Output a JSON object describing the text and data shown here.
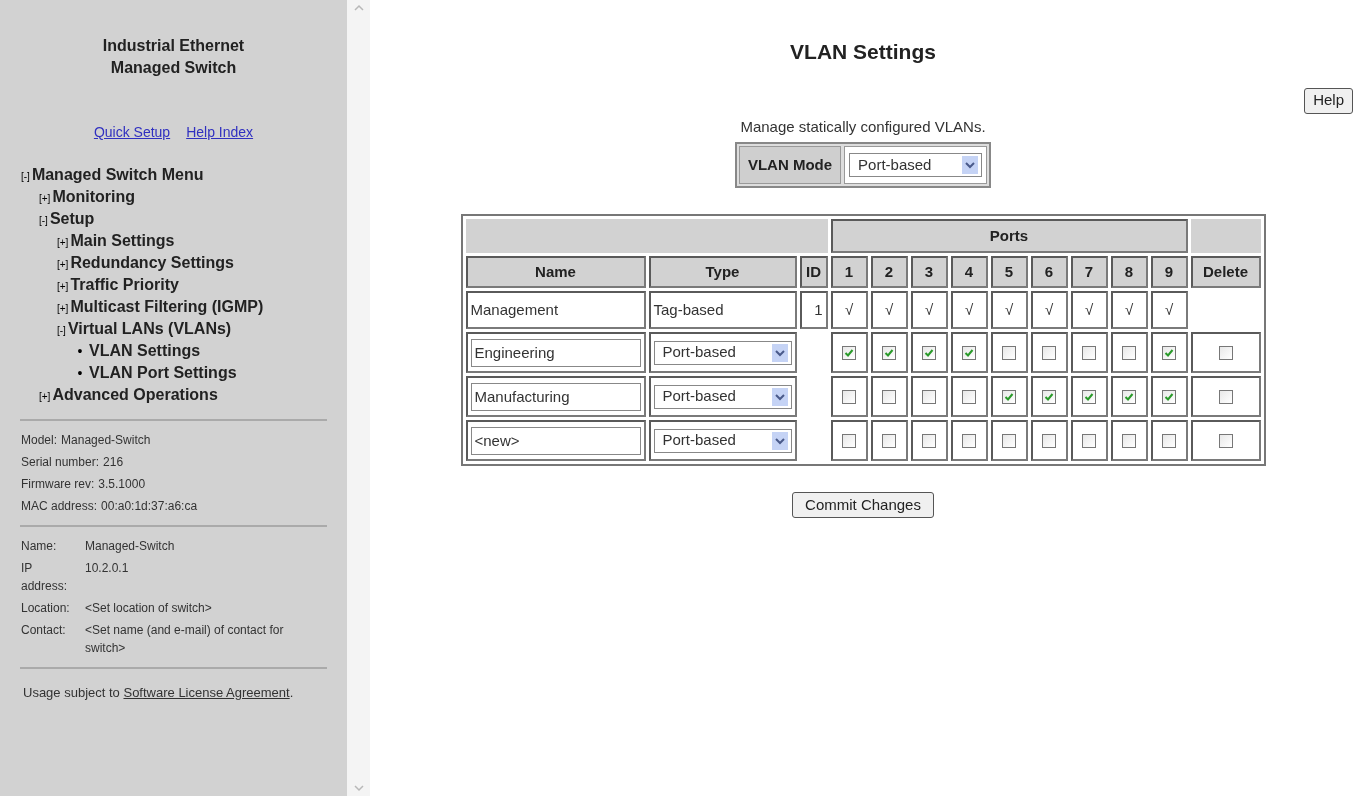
{
  "sidebar": {
    "title": [
      "Industrial Ethernet",
      "Managed Switch"
    ],
    "links": [
      "Quick Setup",
      "Help Index"
    ],
    "menu": [
      {
        "marker": "[-]",
        "label": "Managed Switch Menu",
        "children": [
          {
            "marker": "[+]",
            "label": "Monitoring"
          },
          {
            "marker": "[-]",
            "label": "Setup",
            "children": [
              {
                "marker": "[+]",
                "label": "Main Settings"
              },
              {
                "marker": "[+]",
                "label": "Redundancy Settings"
              },
              {
                "marker": "[+]",
                "label": "Traffic Priority"
              },
              {
                "marker": "[+]",
                "label": "Multicast Filtering (IGMP)"
              },
              {
                "marker": "[-]",
                "label": "Virtual LANs (VLANs)",
                "children": [
                  {
                    "marker": "•",
                    "label": "VLAN Settings"
                  },
                  {
                    "marker": "•",
                    "label": "VLAN Port Settings"
                  }
                ]
              }
            ]
          },
          {
            "marker": "[+]",
            "label": "Advanced Operations"
          }
        ]
      }
    ],
    "device_info": [
      {
        "label": "Model:",
        "value": "Managed-Switch"
      },
      {
        "label": "Serial number:",
        "value": "216"
      },
      {
        "label": "Firmware rev:",
        "value": "3.5.1000"
      },
      {
        "label": "MAC address:",
        "value": "00:a0:1d:37:a6:ca"
      }
    ],
    "switch_info": [
      {
        "label": "Name:",
        "value": "Managed-Switch"
      },
      {
        "label": "IP address:",
        "value": "10.2.0.1"
      },
      {
        "label": "Location:",
        "value": "<Set location of switch>"
      },
      {
        "label": "Contact:",
        "value": "<Set name (and e-mail) of contact for switch>"
      }
    ],
    "license": {
      "text": "Usage subject to",
      "link": "Software License Agreement",
      "end": "."
    }
  },
  "main": {
    "title": "VLAN Settings",
    "help_button": "Help",
    "description": "Manage statically configured VLANs.",
    "vlan_mode": {
      "label": "VLAN Mode",
      "value": "Port-based"
    },
    "table": {
      "group_header": "Ports",
      "columns": [
        "Name",
        "Type",
        "ID",
        "1",
        "2",
        "3",
        "4",
        "5",
        "6",
        "7",
        "8",
        "9",
        "Delete"
      ],
      "rows": [
        {
          "kind": "fixed",
          "name": "Management",
          "type": "Tag-based",
          "id": "1",
          "ports": [
            "√",
            "√",
            "√",
            "√",
            "√",
            "√",
            "√",
            "√",
            "√"
          ]
        },
        {
          "kind": "editable",
          "name": "Engineering",
          "type": "Port-based",
          "ports": [
            true,
            true,
            true,
            true,
            false,
            false,
            false,
            false,
            true
          ],
          "delete": false
        },
        {
          "kind": "editable",
          "name": "Manufacturing",
          "type": "Port-based",
          "ports": [
            false,
            false,
            false,
            false,
            true,
            true,
            true,
            true,
            true
          ],
          "delete": false
        },
        {
          "kind": "editable",
          "name": "<new>",
          "type": "Port-based",
          "ports": [
            false,
            false,
            false,
            false,
            false,
            false,
            false,
            false,
            false
          ],
          "delete": false
        }
      ]
    },
    "commit_button": "Commit Changes"
  }
}
